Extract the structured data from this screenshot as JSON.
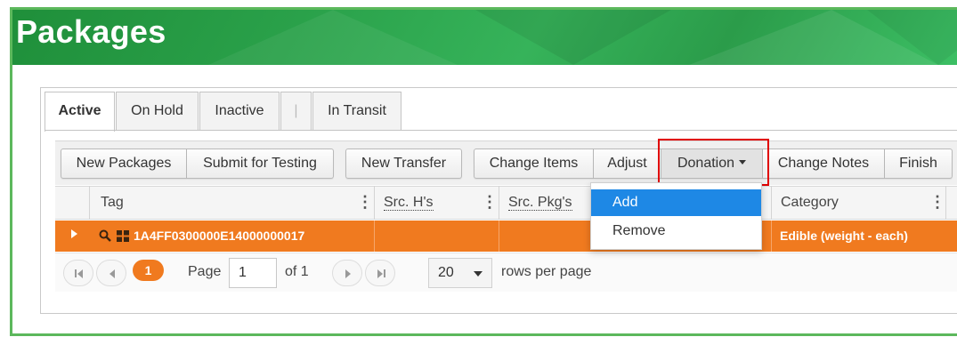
{
  "page": {
    "title": "Packages"
  },
  "tabs": [
    {
      "label": "Active",
      "active": true
    },
    {
      "label": "On Hold",
      "active": false
    },
    {
      "label": "Inactive",
      "active": false
    },
    {
      "label": "|",
      "active": false
    },
    {
      "label": "In Transit",
      "active": false
    }
  ],
  "toolbar": {
    "new_packages": "New Packages",
    "submit_for_testing": "Submit for Testing",
    "new_transfer": "New Transfer",
    "change_items": "Change Items",
    "adjust": "Adjust",
    "donation": "Donation",
    "change_notes": "Change Notes",
    "finish": "Finish"
  },
  "donation_menu": {
    "items": [
      "Add",
      "Remove"
    ],
    "highlighted": "Add"
  },
  "grid": {
    "columns": {
      "tag": "Tag",
      "src_hs": "Src. H's",
      "src_pkgs": "Src. Pkg's",
      "category": "Category"
    },
    "column_menu_glyph": "⋮",
    "rows": [
      {
        "tag": "1A4FF0300000E14000000017",
        "category": "Edible (weight - each)",
        "selected": true
      }
    ]
  },
  "pager": {
    "current_page": "1",
    "page_label": "Page",
    "page_input_value": "1",
    "of_label": "of 1",
    "page_size": "20",
    "rows_per_page_label": "rows per page"
  },
  "colors": {
    "header_green": "#2aa14a",
    "border_green": "#5cb85c",
    "row_orange": "#f07a1f",
    "menu_highlight": "#1e88e5",
    "callout_red": "#e00000"
  },
  "icons": [
    "search-icon",
    "grid-icon",
    "caret-down-icon",
    "expand-row-icon",
    "first-page-icon",
    "prev-page-icon",
    "next-page-icon",
    "last-page-icon"
  ]
}
